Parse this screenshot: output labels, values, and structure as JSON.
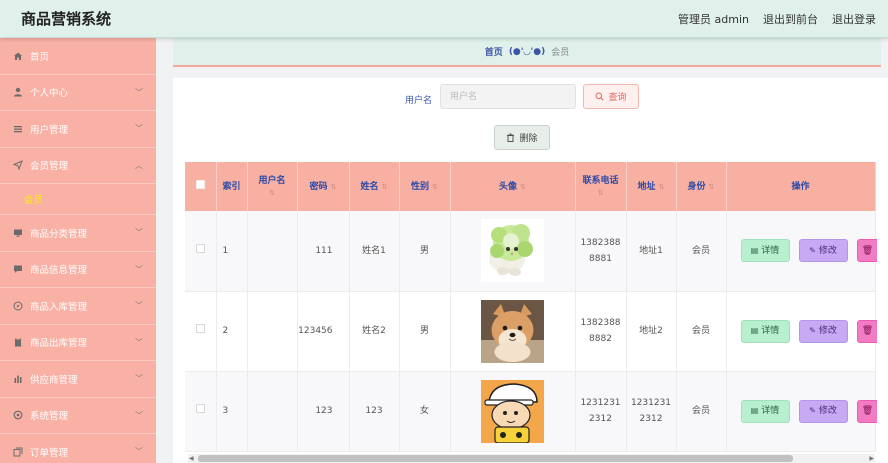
{
  "app": {
    "title": "商品营销系统",
    "admin_label": "管理员 admin",
    "front_link": "退出到前台",
    "logout_link": "退出登录"
  },
  "sidebar": {
    "items": [
      {
        "label": "首页",
        "icon": "home-icon"
      },
      {
        "label": "个人中心",
        "icon": "user-icon"
      },
      {
        "label": "用户管理",
        "icon": "list-icon"
      },
      {
        "label": "会员管理",
        "icon": "send-icon"
      },
      {
        "label": "会员",
        "icon": ""
      },
      {
        "label": "商品分类管理",
        "icon": "monitor-icon"
      },
      {
        "label": "商品信息管理",
        "icon": "chat-icon"
      },
      {
        "label": "商品入库管理",
        "icon": "compass-icon"
      },
      {
        "label": "商品出库管理",
        "icon": "clipboard-icon"
      },
      {
        "label": "供应商管理",
        "icon": "chart-icon"
      },
      {
        "label": "系统管理",
        "icon": "settings-icon"
      },
      {
        "label": "订单管理",
        "icon": "copy-icon"
      }
    ]
  },
  "breadcrumb": {
    "home": "首页",
    "face": "(●'◡'●)",
    "current": "会员"
  },
  "search": {
    "label": "用户名",
    "placeholder": "用户名",
    "button": "查询",
    "delete_button": "删除"
  },
  "table": {
    "headers": [
      "索引",
      "用户名",
      "密码",
      "姓名",
      "性别",
      "头像",
      "联系电话",
      "地址",
      "身份",
      "操作"
    ],
    "rows": [
      {
        "index": "1",
        "username": "",
        "password": "111",
        "name": "姓名1",
        "gender": "男",
        "avatar": "cabbage-cat-avatar",
        "phone": [
          "1382388",
          "8881"
        ],
        "address": "地址1",
        "role": "会员"
      },
      {
        "index": "2",
        "username": "",
        "password": "123456",
        "name": "姓名2",
        "gender": "男",
        "avatar": "shiba-dog-avatar",
        "phone": [
          "1382388",
          "8882"
        ],
        "address": "地址2",
        "role": "会员"
      },
      {
        "index": "3",
        "username": "",
        "password": "123",
        "name": "123",
        "gender": "女",
        "avatar": "cartoon-boy-avatar",
        "phone": [
          "1231231",
          "2312"
        ],
        "address": [
          "1231231",
          "2312"
        ],
        "role": "会员"
      }
    ],
    "op_detail": "详情",
    "op_edit": "修改"
  },
  "colors": {
    "sidebar_bg": "#f9b1a5",
    "topbar_bg": "#dff1ea",
    "header_bg": "#f8b0a3",
    "header_text": "#2b4aa8",
    "submenu_active": "#f7f000"
  }
}
